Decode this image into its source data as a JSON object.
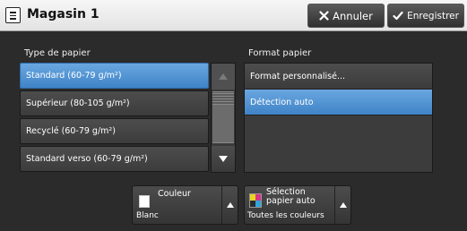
{
  "header": {
    "title": "Magasin 1",
    "cancel_label": "Annuler",
    "save_label": "Enregistrer"
  },
  "paper_type": {
    "label": "Type de papier",
    "items": [
      {
        "label": "Standard (60-79 g/m²)",
        "selected": true
      },
      {
        "label": "Supérieur (80-105 g/m²)",
        "selected": false
      },
      {
        "label": "Recyclé (60-79 g/m²)",
        "selected": false
      },
      {
        "label": "Standard verso (60-79 g/m²)",
        "selected": false
      }
    ]
  },
  "paper_format": {
    "label": "Format papier",
    "items": [
      {
        "label": "Format personnalisé...",
        "selected": false
      },
      {
        "label": "Détection auto",
        "selected": true
      }
    ]
  },
  "color_button": {
    "label": "Couleur",
    "value": "Blanc"
  },
  "source_button": {
    "label_line1": "Sélection",
    "label_line2": "papier auto",
    "value": "Toutes les couleurs"
  },
  "colors": {
    "selected": "#4a8fd3",
    "button": "#404040",
    "background": "#2b2b2b"
  }
}
